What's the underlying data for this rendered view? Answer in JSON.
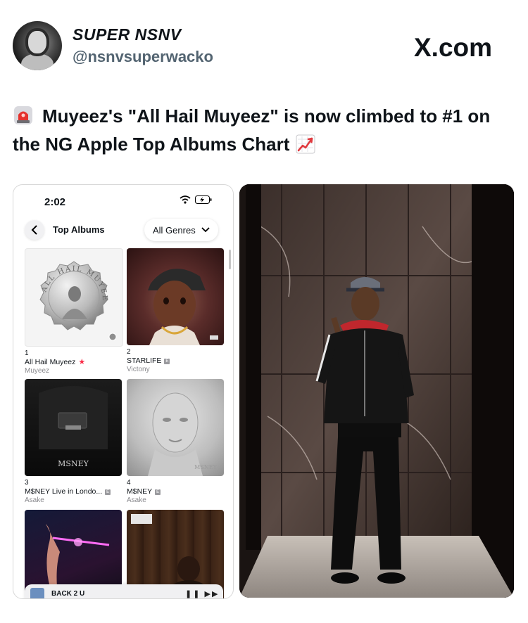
{
  "header": {
    "display_name": "SUPER NSNV",
    "handle": "@nsnvsuperwacko",
    "site": "X.com",
    "icons": [
      "avatar",
      "x-logo-icon"
    ]
  },
  "tweet": {
    "text": "Muyeez's \"All Hail Muyeez\" is now climbed to #1 on the NG Apple Top Albums Chart",
    "leading_emoji": "siren-icon",
    "trailing_emoji": "chart-increasing-icon"
  },
  "phone": {
    "time": "2:02",
    "status_icons": [
      "wifi-icon",
      "battery-charging-icon"
    ],
    "nav_title": "Top Albums",
    "genre_filter": "All Genres",
    "albums": [
      {
        "rank": "1",
        "title": "All Hail Muyeez",
        "artist": "Muyeez",
        "marker": "★",
        "explicit": false
      },
      {
        "rank": "2",
        "title": "STARLIFE",
        "artist": "Victony",
        "marker": "",
        "explicit": true
      },
      {
        "rank": "3",
        "title": "M$NEY Live in Londo...",
        "artist": "Asake",
        "marker": "",
        "explicit": true
      },
      {
        "rank": "4",
        "title": "M$NEY",
        "artist": "Asake",
        "marker": "",
        "explicit": true
      }
    ],
    "cover_text": {
      "coin": "ALL HAIL MUYEEZ",
      "msney_live": "MSNEY",
      "msney": "MSNEY"
    },
    "now_playing": "BACK 2 U",
    "colors": {
      "accent": "#fa2d48",
      "secondary_text": "#8a8a8e"
    }
  }
}
